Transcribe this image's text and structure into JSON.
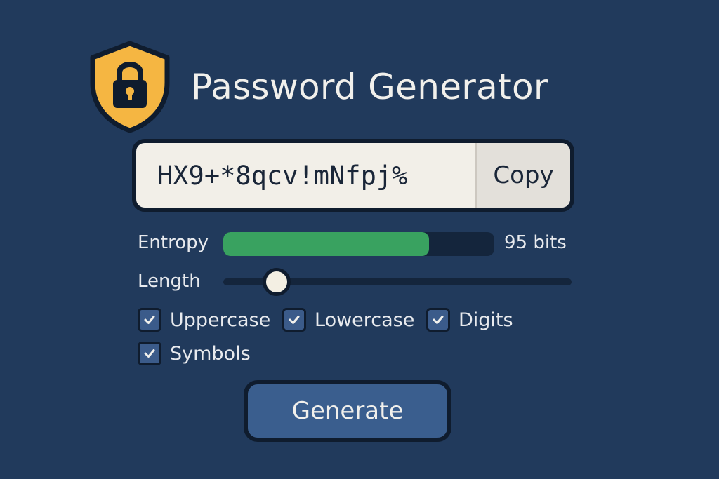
{
  "app": {
    "title": "Password Generator",
    "logo_icon": "shield-lock-icon",
    "accent_color": "#f5b642"
  },
  "password": {
    "value": "HX9+*8qcv!mNfpj%",
    "copy_label": "Copy"
  },
  "entropy": {
    "label": "Entropy",
    "value_text": "95 bits",
    "fill_fraction": 0.76,
    "fill_color": "#39a260"
  },
  "length": {
    "label": "Length",
    "slider_fraction": 0.15
  },
  "options": [
    {
      "label": "Uppercase",
      "checked": true
    },
    {
      "label": "Lowercase",
      "checked": true
    },
    {
      "label": "Digits",
      "checked": true
    },
    {
      "label": "Symbols",
      "checked": true
    }
  ],
  "generate_label": "Generate"
}
